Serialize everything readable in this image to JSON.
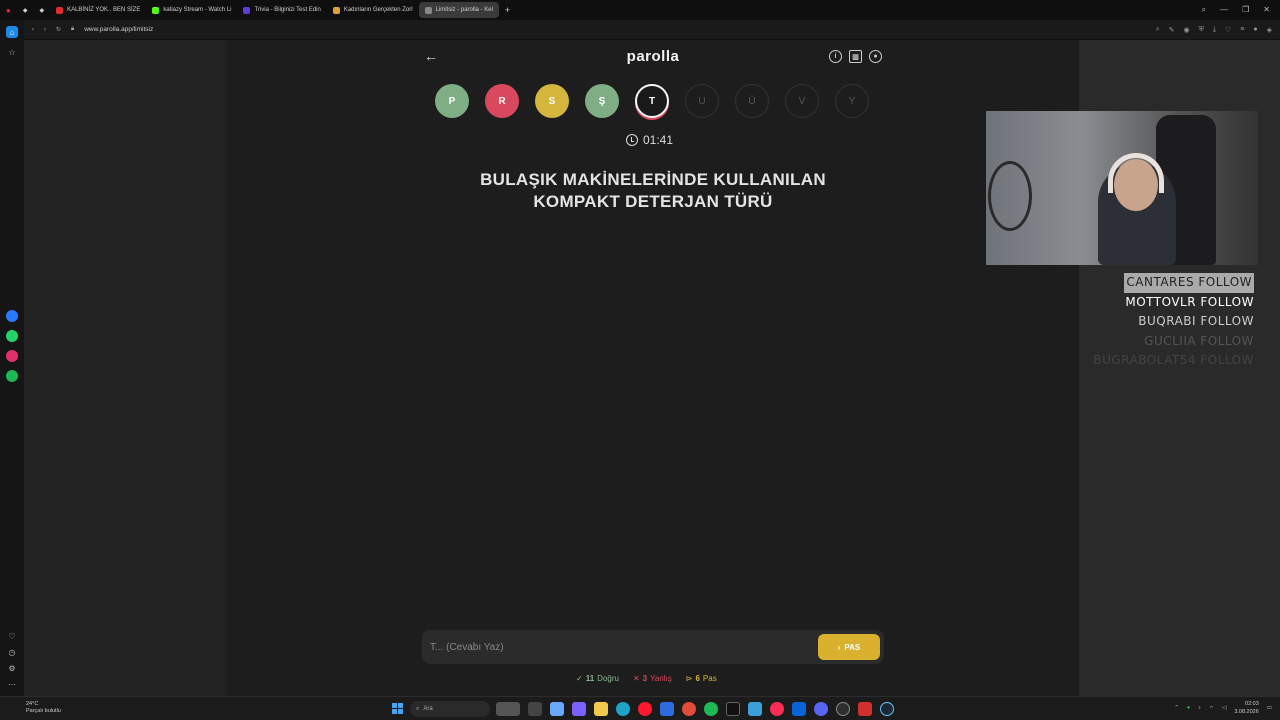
{
  "browser": {
    "tabs": [
      {
        "label": "KALBİNİZ YOK.. BEN SİZE",
        "color": "#e22b2b"
      },
      {
        "label": "katiazy Stream - Watch Li",
        "color": "#53fc18"
      },
      {
        "label": "Trivia - Bilginizi Test Edin",
        "color": "#5b3bdc"
      },
      {
        "label": "Kadınların Gerçekten Zorl",
        "color": "#e0a13b"
      },
      {
        "label": "Limitsiz - parolla - Kel",
        "color": "#888888"
      }
    ],
    "url": "www.parolla.app/limitsiz"
  },
  "game": {
    "logo": "parolla",
    "letters": [
      {
        "char": "P",
        "state": "green"
      },
      {
        "char": "R",
        "state": "red"
      },
      {
        "char": "S",
        "state": "yellow"
      },
      {
        "char": "Ş",
        "state": "green"
      },
      {
        "char": "T",
        "state": "current"
      },
      {
        "char": "U",
        "state": "pending"
      },
      {
        "char": "Ü",
        "state": "pending"
      },
      {
        "char": "V",
        "state": "pending"
      },
      {
        "char": "Y",
        "state": "pending"
      }
    ],
    "timer": "01:41",
    "question": "BULAŞIK MAKİNELERİNDE KULLANILAN KOMPAKT DETERJAN TÜRÜ",
    "answer_placeholder": "T... (Cevabı Yaz)",
    "pass_label": "PAS",
    "stats": {
      "correct_count": "11",
      "correct_label": "Doğru",
      "wrong_count": "3",
      "wrong_label": "Yanlış",
      "pass_count": "6",
      "pass_label": "Pas"
    },
    "colors": {
      "green": "#7fae84",
      "red": "#d9495d",
      "yellow": "#d4b63c"
    }
  },
  "overlay": {
    "followers": [
      "CANTARES FOLLOW",
      "MOTTOVLR FOLLOW",
      "BUQRABI FOLLOW",
      "GUCLIIA FOLLOW",
      "BUGRABOLAT54 FOLLOW"
    ]
  },
  "taskbar": {
    "temperature": "24°C",
    "weather": "Parçalı bulutlu",
    "search_placeholder": "Ara",
    "time": "02:03",
    "date": "3.08.2026"
  }
}
